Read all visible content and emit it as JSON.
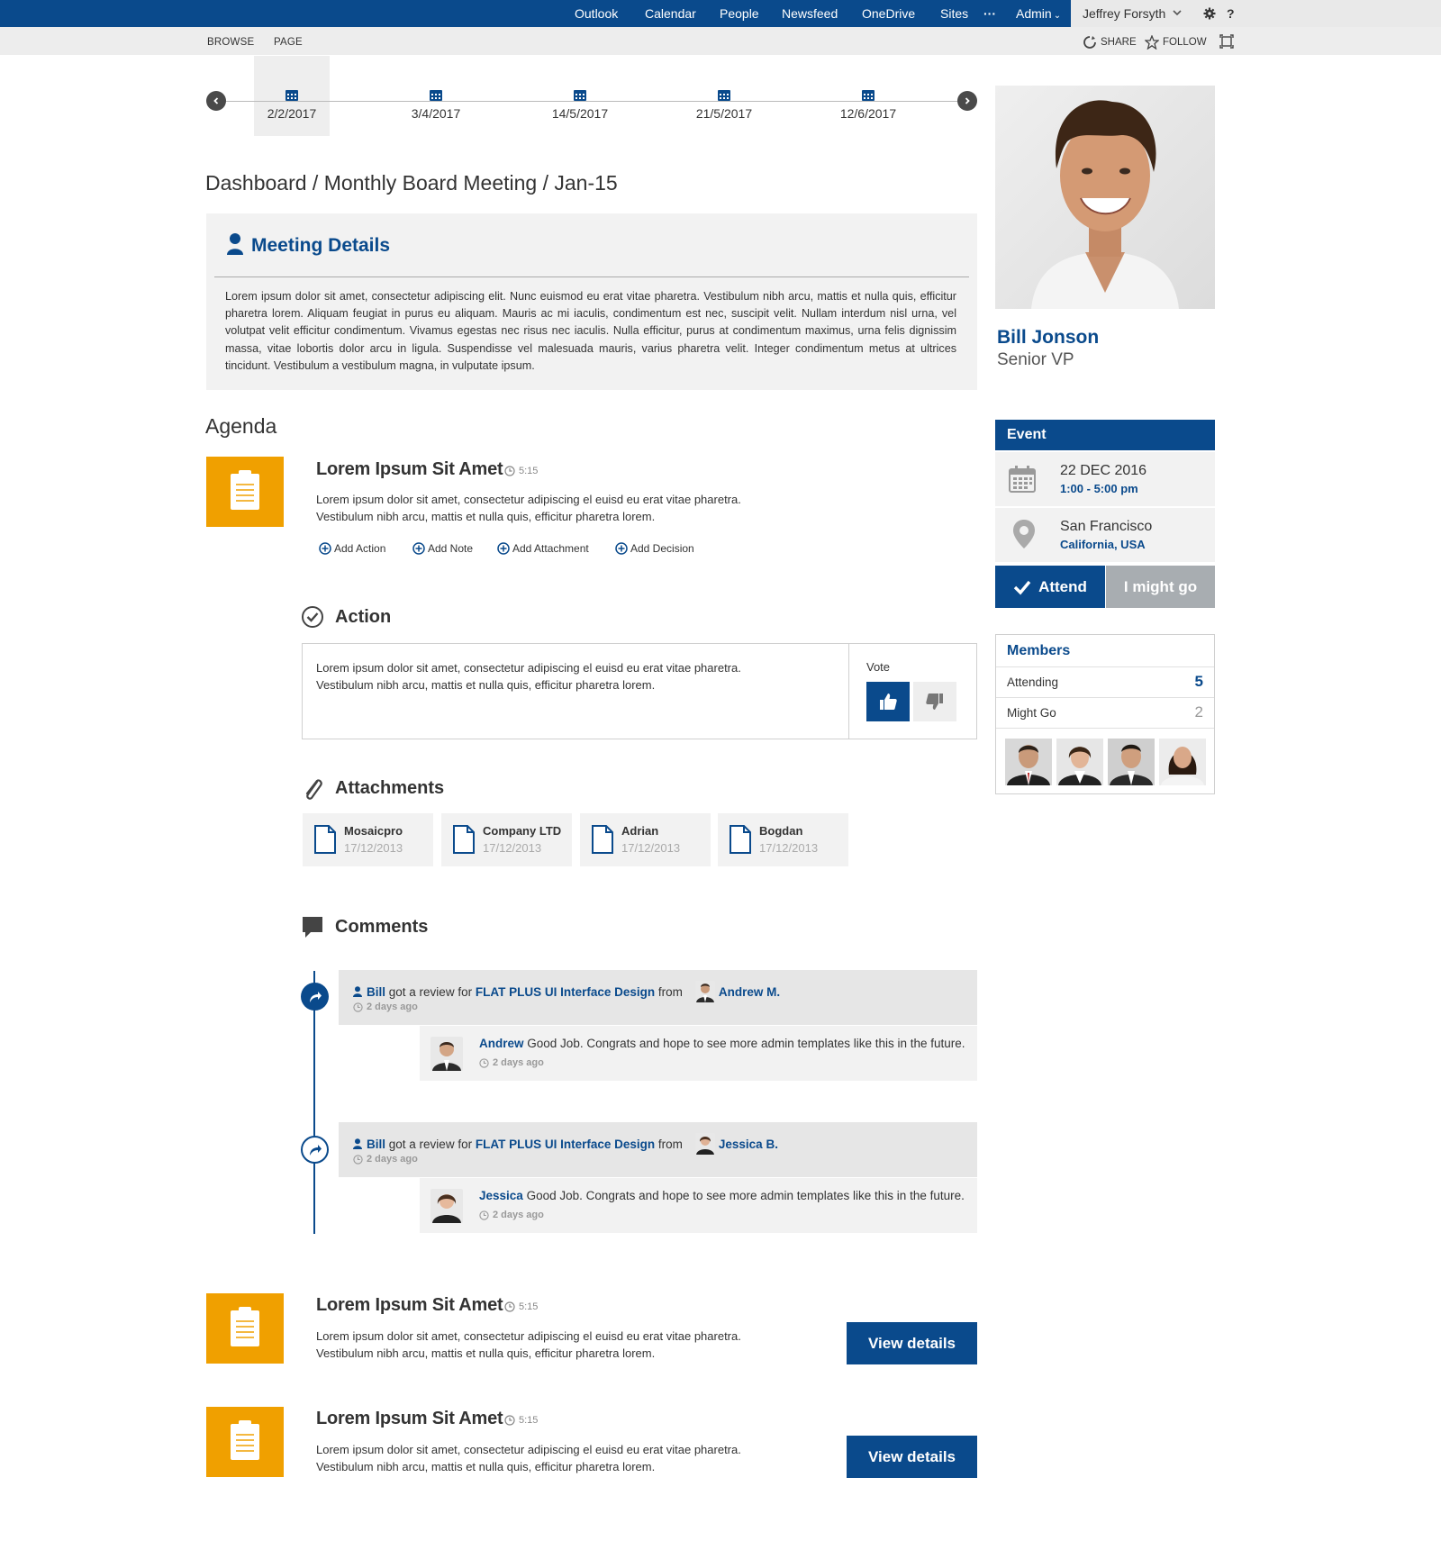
{
  "topnav": {
    "items": [
      "Outlook",
      "Calendar",
      "People",
      "Newsfeed",
      "OneDrive",
      "Sites",
      "···",
      "Admin"
    ],
    "user": "Jeffrey Forsyth",
    "help": "?"
  },
  "subnav": {
    "tabs": [
      "BROWSE",
      "PAGE"
    ],
    "share": "SHARE",
    "follow": "FOLLOW"
  },
  "timeline": {
    "dates": [
      "2/2/2017",
      "3/4/2017",
      "14/5/2017",
      "21/5/2017",
      "12/6/2017"
    ],
    "active_index": 0
  },
  "breadcrumb": "Dashboard / Monthly Board Meeting / Jan-15",
  "meeting": {
    "title": "Meeting Details",
    "body": "Lorem ipsum dolor sit amet, consectetur adipiscing elit. Nunc euismod eu erat vitae pharetra. Vestibulum nibh arcu, mattis et nulla quis, efficitur pharetra lorem. Aliquam feugiat in purus eu aliquam. Mauris ac mi iaculis, condimentum est nec, suscipit velit. Nullam interdum nisl urna, vel volutpat velit efficitur condimentum. Vivamus egestas nec risus nec iaculis. Nulla efficitur, purus at condimentum maximus, urna felis dignissim massa, vitae lobortis dolor arcu in ligula. Suspendisse vel malesuada mauris, varius pharetra velit. Integer condimentum metus at ultrices tincidunt. Vestibulum a vestibulum magna, in vulputate ipsum."
  },
  "agenda": {
    "title": "Agenda",
    "items": [
      {
        "title": "Lorem Ipsum Sit Amet",
        "time": "5:15",
        "desc_line1": "Lorem ipsum dolor sit amet, consectetur adipiscing el euisd eu erat vitae pharetra.",
        "desc_line2": "Vestibulum nibh arcu, mattis et nulla quis, efficitur pharetra lorem."
      },
      {
        "title": "Lorem Ipsum Sit Amet",
        "time": "5:15",
        "desc_line1": "Lorem ipsum dolor sit amet, consectetur adipiscing el euisd eu erat vitae pharetra.",
        "desc_line2": "Vestibulum nibh arcu, mattis et nulla quis, efficitur pharetra lorem.",
        "button": "View details"
      },
      {
        "title": "Lorem Ipsum Sit Amet",
        "time": "5:15",
        "desc_line1": "Lorem ipsum dolor sit amet, consectetur adipiscing el euisd eu erat vitae pharetra.",
        "desc_line2": "Vestibulum nibh arcu, mattis et nulla quis, efficitur pharetra lorem.",
        "button": "View details"
      }
    ],
    "actions": [
      "Add Action",
      "Add Note",
      "Add Attachment",
      "Add Decision"
    ]
  },
  "action": {
    "title": "Action",
    "line1": "Lorem ipsum dolor sit amet, consectetur adipiscing el euisd eu erat vitae pharetra.",
    "line2": "Vestibulum nibh arcu, mattis et nulla quis, efficitur pharetra lorem.",
    "vote_label": "Vote"
  },
  "attachments": {
    "title": "Attachments",
    "files": [
      {
        "name": "Mosaicpro",
        "date": "17/12/2013"
      },
      {
        "name": "Company LTD",
        "date": "17/12/2013"
      },
      {
        "name": "Adrian",
        "date": "17/12/2013"
      },
      {
        "name": "Bogdan",
        "date": "17/12/2013"
      }
    ]
  },
  "comments": {
    "title": "Comments",
    "threads": [
      {
        "author": "Bill",
        "mid": "got a review for",
        "product": "FLAT PLUS UI Interface Design",
        "from": "from",
        "reviewer": "Andrew M.",
        "ago": "2 days ago",
        "reply_author": "Andrew",
        "reply_text": "Good Job. Congrats and hope to see more admin templates like this in the future.",
        "reply_ago": "2 days ago"
      },
      {
        "author": "Bill",
        "mid": "got a review for",
        "product": "FLAT PLUS UI Interface Design",
        "from": "from",
        "reviewer": "Jessica B.",
        "ago": "2 days ago",
        "reply_author": "Jessica",
        "reply_text": "Good Job. Congrats and hope to see more admin templates like this in the future.",
        "reply_ago": "2 days ago"
      }
    ]
  },
  "profile": {
    "name": "Bill Jonson",
    "role": "Senior VP"
  },
  "event": {
    "title": "Event",
    "date": "22 DEC 2016",
    "time": "1:00 - 5:00 pm",
    "city": "San Francisco",
    "region": "California, USA",
    "attend_label": "Attend",
    "might_label": "I might go"
  },
  "members": {
    "title": "Members",
    "attending_label": "Attending",
    "attending_count": "5",
    "might_label": "Might Go",
    "might_count": "2"
  },
  "colors": {
    "brand": "#0a4a8c",
    "accent": "#f0a000",
    "panel": "#f2f2f2"
  }
}
